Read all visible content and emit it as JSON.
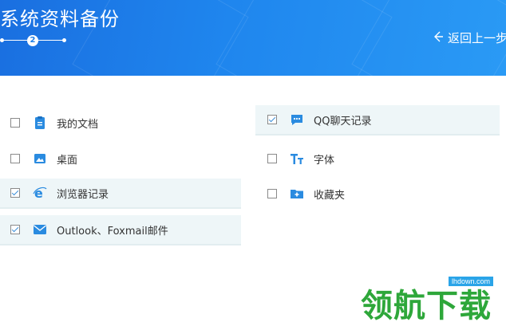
{
  "header": {
    "title": "系统资料备份",
    "step_current": "2",
    "back_label": "返回上一步"
  },
  "items_left": [
    {
      "label": "我的文档",
      "checked": false,
      "icon": "document-icon"
    },
    {
      "label": "桌面",
      "checked": false,
      "icon": "desktop-icon"
    },
    {
      "label": "浏览器记录",
      "checked": true,
      "icon": "ie-browser-icon"
    },
    {
      "label": "Outlook、Foxmail邮件",
      "checked": true,
      "icon": "mail-icon"
    }
  ],
  "items_right": [
    {
      "label": "QQ聊天记录",
      "checked": true,
      "icon": "chat-icon"
    },
    {
      "label": "字体",
      "checked": false,
      "icon": "font-icon"
    },
    {
      "label": "收藏夹",
      "checked": false,
      "icon": "favorites-folder-icon"
    }
  ],
  "watermark": {
    "brand": "领航下载",
    "site": "lhdown.com"
  },
  "colors": {
    "header": "#1f86ee",
    "icon": "#2a8be0",
    "selected_bg": "#eef6f8",
    "brand": "#2ea73a"
  }
}
